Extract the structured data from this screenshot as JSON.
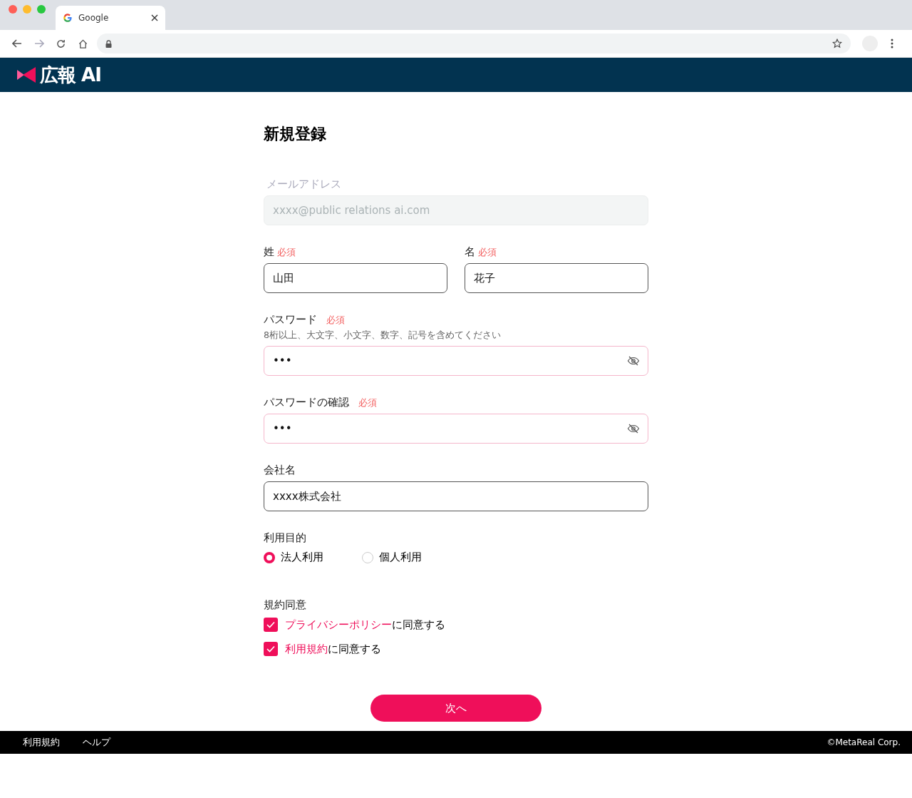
{
  "browser": {
    "tab_title": "Google"
  },
  "header": {
    "logo": "広報 AI"
  },
  "page_title": "新規登録",
  "email": {
    "label": "メールアドレス",
    "value": "xxxx@public relations ai.com",
    "disabled": true
  },
  "name_fields": [
    {
      "label": "姓",
      "required": "必須",
      "value": "山田"
    },
    {
      "label": "名",
      "required": "必須",
      "value": "花子"
    }
  ],
  "password_fields": [
    {
      "label": "パスワード",
      "required": "必須",
      "hint": "8桁以上、大文字、小文字、数字、記号を含めてください",
      "value": "•••"
    },
    {
      "label": "パスワードの確認",
      "required": "必須",
      "value": "•••"
    }
  ],
  "company": {
    "label": "会社名",
    "value": "xxxx株式会社"
  },
  "purpose": {
    "label": "利用目的",
    "options": [
      {
        "label": "法人利用",
        "selected": true
      },
      {
        "label": "個人利用",
        "selected": false
      }
    ]
  },
  "agreement": {
    "label": "規約同意",
    "items": [
      {
        "link": "プライバシーポリシー",
        "text": "に同意する",
        "checked": true
      },
      {
        "link": "利用規約",
        "text": "に同意する",
        "checked": true
      }
    ]
  },
  "next_button": "次へ",
  "footer": {
    "links": [
      "利用規約",
      "ヘルプ"
    ],
    "copyright": "©MetaReal Corp."
  }
}
